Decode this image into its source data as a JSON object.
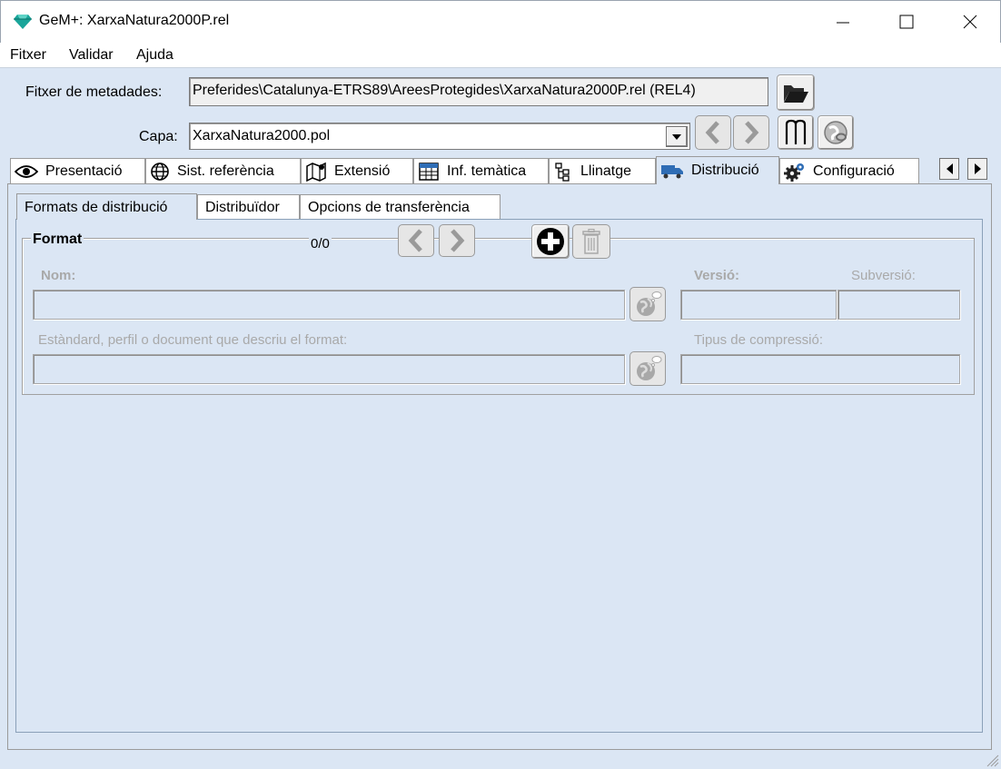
{
  "window": {
    "title": "GeM+: XarxaNatura2000P.rel"
  },
  "menu": {
    "items": [
      "Fitxer",
      "Validar",
      "Ajuda"
    ]
  },
  "metadata_file": {
    "label": "Fitxer de metadades:",
    "value": "Preferides\\Catalunya-ETRS89\\AreesProtegides\\XarxaNatura2000P.rel (REL4)"
  },
  "layer": {
    "label": "Capa:",
    "value": "XarxaNatura2000.pol"
  },
  "tabs": [
    {
      "label": "Presentació",
      "icon": "eye-icon"
    },
    {
      "label": "Sist. referència",
      "icon": "globe-icon"
    },
    {
      "label": "Extensió",
      "icon": "map-icon"
    },
    {
      "label": "Inf. temàtica",
      "icon": "table-icon"
    },
    {
      "label": "Llinatge",
      "icon": "tree-icon"
    },
    {
      "label": "Distribució",
      "icon": "truck-icon",
      "active": true
    },
    {
      "label": "Configuració",
      "icon": "gears-icon"
    }
  ],
  "subtabs": [
    {
      "label": "Formats de distribució",
      "active": true
    },
    {
      "label": "Distribuïdor"
    },
    {
      "label": "Opcions de transferència"
    }
  ],
  "format_group": {
    "title": "Format",
    "counter": "0/0",
    "name_label": "Nom:",
    "version_label": "Versió:",
    "subversion_label": "Subversió:",
    "standard_label": "Estàndard, perfil o document que descriu el format:",
    "compression_label": "Tipus de compressió:"
  },
  "colors": {
    "background": "#dbe6f4",
    "tab_active": "#dbe6f4",
    "disabled_text": "#a9a9a9"
  }
}
